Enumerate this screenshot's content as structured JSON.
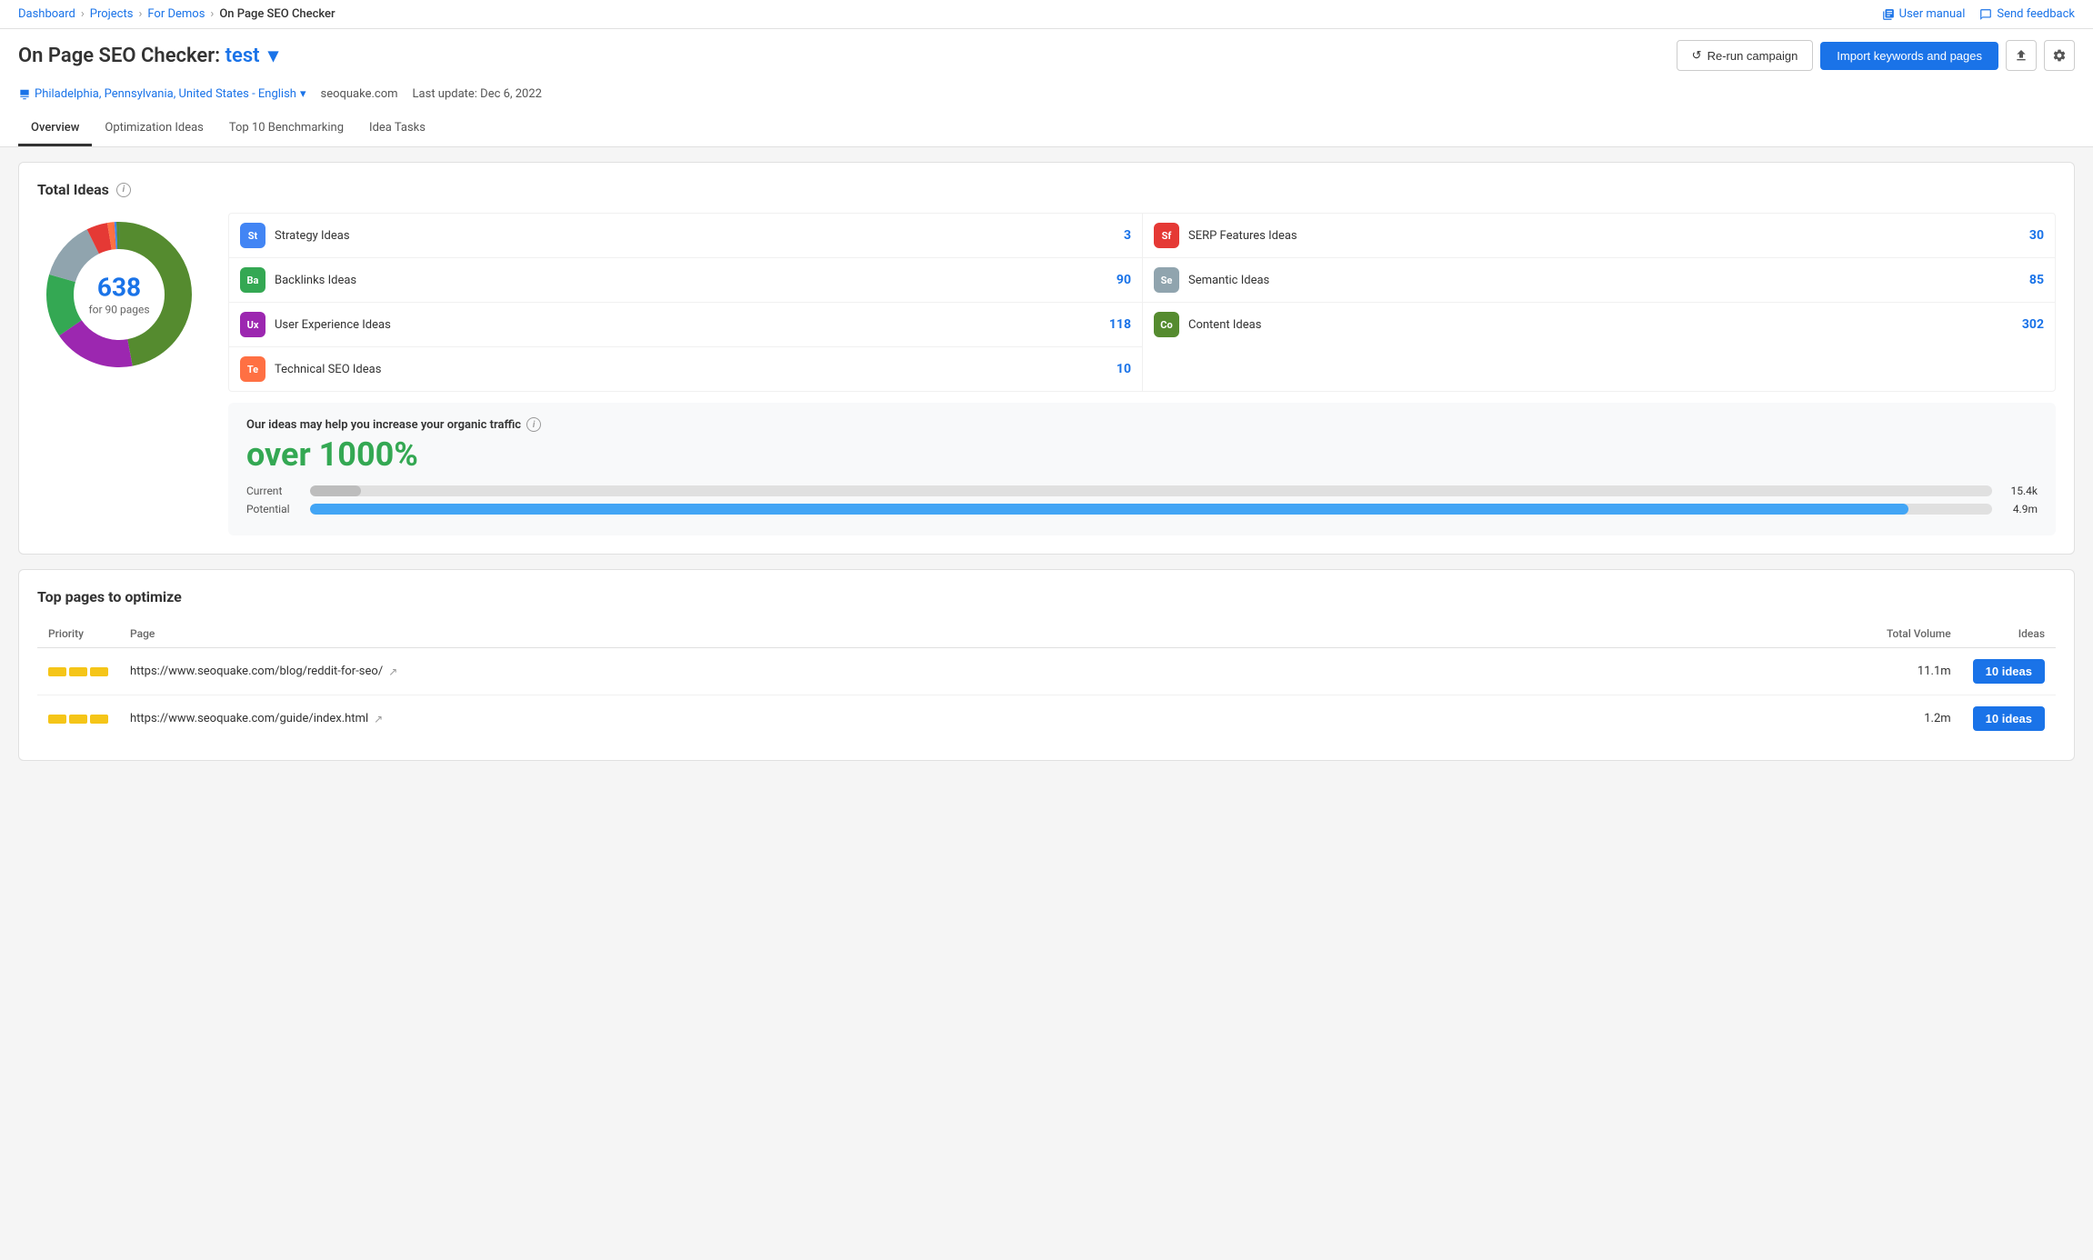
{
  "breadcrumb": {
    "items": [
      "Dashboard",
      "Projects",
      "For Demos",
      "On Page SEO Checker"
    ]
  },
  "topActions": {
    "userManual": "User manual",
    "sendFeedback": "Send feedback"
  },
  "header": {
    "title": "On Page SEO Checker:",
    "titleHighlight": "test",
    "location": "Philadelphia, Pennsylvania, United States - English",
    "domain": "seoquake.com",
    "lastUpdate": "Last update: Dec 6, 2022",
    "btnRerun": "Re-run campaign",
    "btnImport": "Import keywords and pages"
  },
  "tabs": [
    {
      "label": "Overview",
      "active": true
    },
    {
      "label": "Optimization Ideas",
      "active": false
    },
    {
      "label": "Top 10 Benchmarking",
      "active": false
    },
    {
      "label": "Idea Tasks",
      "active": false
    }
  ],
  "totalIdeas": {
    "title": "Total Ideas",
    "totalNumber": "638",
    "totalSub": "for 90 pages",
    "ideas": [
      {
        "badge": "St",
        "label": "Strategy Ideas",
        "count": "3",
        "color": "#4285f4"
      },
      {
        "badge": "Ba",
        "label": "Backlinks Ideas",
        "count": "90",
        "color": "#34a853"
      },
      {
        "badge": "Ux",
        "label": "User Experience Ideas",
        "count": "118",
        "color": "#9c27b0"
      },
      {
        "badge": "Te",
        "label": "Technical SEO Ideas",
        "count": "10",
        "color": "#ff7043"
      },
      {
        "badge": "Sf",
        "label": "SERP Features Ideas",
        "count": "30",
        "color": "#e53935"
      },
      {
        "badge": "Se",
        "label": "Semantic Ideas",
        "count": "85",
        "color": "#90a4ae"
      },
      {
        "badge": "Co",
        "label": "Content Ideas",
        "count": "302",
        "color": "#558b2f"
      }
    ]
  },
  "traffic": {
    "title": "Our ideas may help you increase your organic traffic",
    "percent": "over 1000%",
    "current": {
      "label": "Current",
      "value": "15.4k",
      "fill": 3
    },
    "potential": {
      "label": "Potential",
      "value": "4.9m",
      "fill": 95
    }
  },
  "topPages": {
    "title": "Top pages to optimize",
    "columns": [
      "Priority",
      "Page",
      "Total Volume",
      "Ideas"
    ],
    "rows": [
      {
        "priority": 3,
        "url": "https://www.seoquake.com/blog/reddit-for-seo/",
        "volume": "11.1m",
        "ideas": "10 ideas"
      },
      {
        "priority": 3,
        "url": "https://www.seoquake.com/guide/index.html",
        "volume": "1.2m",
        "ideas": "10 ideas"
      }
    ]
  },
  "donut": {
    "segments": [
      {
        "label": "Content",
        "value": 302,
        "color": "#558b2f"
      },
      {
        "label": "User Experience",
        "value": 118,
        "color": "#9c27b0"
      },
      {
        "label": "Backlinks",
        "value": 90,
        "color": "#34a853"
      },
      {
        "label": "Semantic",
        "value": 85,
        "color": "#90a4ae"
      },
      {
        "label": "SERP Features",
        "value": 30,
        "color": "#e53935"
      },
      {
        "label": "Technical",
        "value": 10,
        "color": "#ff7043"
      },
      {
        "label": "Strategy",
        "value": 3,
        "color": "#4285f4"
      }
    ],
    "total": 638
  }
}
